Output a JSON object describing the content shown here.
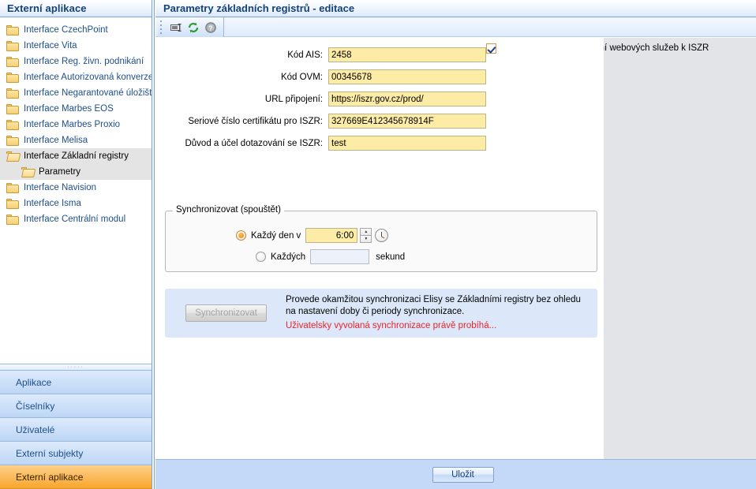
{
  "sidebar": {
    "header_title": "Externí aplikace",
    "tree": [
      {
        "label": "Interface CzechPoint",
        "icon": "folder-icon",
        "level": 0,
        "selected": false
      },
      {
        "label": "Interface Vita",
        "icon": "folder-icon",
        "level": 0,
        "selected": false
      },
      {
        "label": "Interface Reg. živn. podnikání",
        "icon": "folder-icon",
        "level": 0,
        "selected": false
      },
      {
        "label": "Interface Autorizovaná konverze",
        "icon": "folder-icon",
        "level": 0,
        "selected": false
      },
      {
        "label": "Interface Negarantované úložiště",
        "icon": "folder-icon",
        "level": 0,
        "selected": false
      },
      {
        "label": "Interface Marbes EOS",
        "icon": "folder-icon",
        "level": 0,
        "selected": false
      },
      {
        "label": "Interface Marbes Proxio",
        "icon": "folder-icon",
        "level": 0,
        "selected": false
      },
      {
        "label": "Interface Melisa",
        "icon": "folder-icon",
        "level": 0,
        "selected": false
      },
      {
        "label": "Interface Základní registry",
        "icon": "folder-open-icon",
        "level": 0,
        "selected": true
      },
      {
        "label": "Parametry",
        "icon": "folder-open-icon",
        "level": 1,
        "selected": true
      },
      {
        "label": "Interface Navision",
        "icon": "folder-icon",
        "level": 0,
        "selected": false
      },
      {
        "label": "Interface Isma",
        "icon": "folder-icon",
        "level": 0,
        "selected": false
      },
      {
        "label": "Interface Centrální modul",
        "icon": "folder-icon",
        "level": 0,
        "selected": false
      }
    ],
    "splitter_glyph": "·····",
    "nav": [
      {
        "label": "Aplikace",
        "active": false
      },
      {
        "label": "Číselníky",
        "active": false
      },
      {
        "label": "Uživatelé",
        "active": false
      },
      {
        "label": "Externí subjekty",
        "active": false
      },
      {
        "label": "Externí aplikace",
        "active": true
      }
    ]
  },
  "main": {
    "header_title": "Parametry základních registrů - editace",
    "toolbar": [
      {
        "name": "save-record-icon",
        "tooltip": ""
      },
      {
        "name": "refresh-icon",
        "tooltip": ""
      },
      {
        "name": "help-icon",
        "tooltip": ""
      }
    ],
    "form": {
      "fields": [
        {
          "label": "Kód AIS:",
          "value": "2458",
          "placeholder": ""
        },
        {
          "label": "Kód OVM:",
          "value": "00345678",
          "placeholder": ""
        },
        {
          "label": "URL připojení:",
          "value": "https://iszr.gov.cz/prod/",
          "placeholder": ""
        },
        {
          "label": "Seriové číslo certifikátu pro ISZR:",
          "value": "327669E412345678914F",
          "placeholder": ""
        },
        {
          "label": "Důvod a účel dotazování se ISZR:",
          "value": "test",
          "placeholder": ""
        }
      ],
      "async_checkbox": {
        "label": "Povolit asynchronní volání webových služeb k ISZR",
        "checked": true
      }
    },
    "schedule": {
      "legend": "Synchronizovat (spouštět)",
      "daily": {
        "label": "Každý den v",
        "selected": true,
        "time_value": "6:00",
        "spin_up_glyph": "▲",
        "spin_down_glyph": "▼",
        "clock_icon": "clock-icon"
      },
      "interval": {
        "label": "Každých",
        "selected": false,
        "value": "",
        "placeholder": "",
        "unit": "sekund"
      }
    },
    "info_panel": {
      "button_label": "Synchronizovat",
      "button_disabled": true,
      "description": "Provede okamžitou synchronizaci Elisy se Základními registry bez ohledu na nastavení doby či periody synchronizace.",
      "status": "Uživatelsky vyvolaná synchronizace právě probíhá...",
      "status_color": "#e8252b"
    },
    "footer": {
      "save_label": "Uložit"
    }
  },
  "colors": {
    "header_text": "#14417a",
    "field_bg": "#fdeca6",
    "accent_orange": "#f9a62c",
    "panel_blue": "#dce8f9",
    "footer_blue": "#c4d8f7",
    "content_gray": "#e2e4e8"
  }
}
